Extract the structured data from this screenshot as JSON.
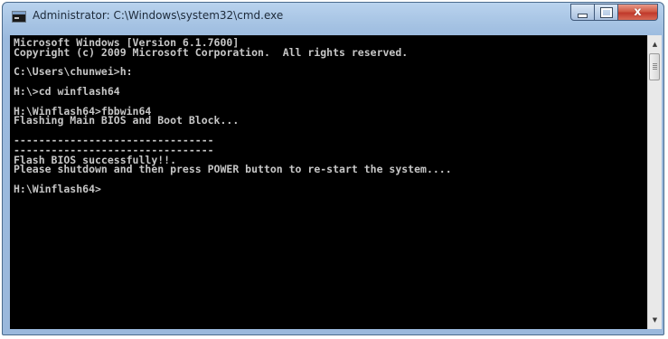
{
  "window": {
    "title": "Administrator: C:\\Windows\\system32\\cmd.exe",
    "icon": "console-icon",
    "buttons": {
      "minimize_icon": "minimize-icon",
      "maximize_icon": "maximize-icon",
      "close_icon": "close-icon",
      "close_glyph": "x"
    }
  },
  "console": {
    "background": "#000000",
    "text_color": "#c6c6c6",
    "lines": [
      "Microsoft Windows [Version 6.1.7600]",
      "Copyright (c) 2009 Microsoft Corporation.  All rights reserved.",
      "",
      "C:\\Users\\chunwei>h:",
      "",
      "H:\\>cd winflash64",
      "",
      "H:\\Winflash64>fbbwin64",
      "Flashing Main BIOS and Boot Block...",
      "",
      "--------------------------------",
      "--------------------------------",
      "Flash BIOS successfully!!.",
      "Please shutdown and then press POWER button to re-start the system....",
      "",
      "H:\\Winflash64>"
    ]
  },
  "scrollbar": {
    "up_arrow": "▲",
    "down_arrow": "▼"
  }
}
